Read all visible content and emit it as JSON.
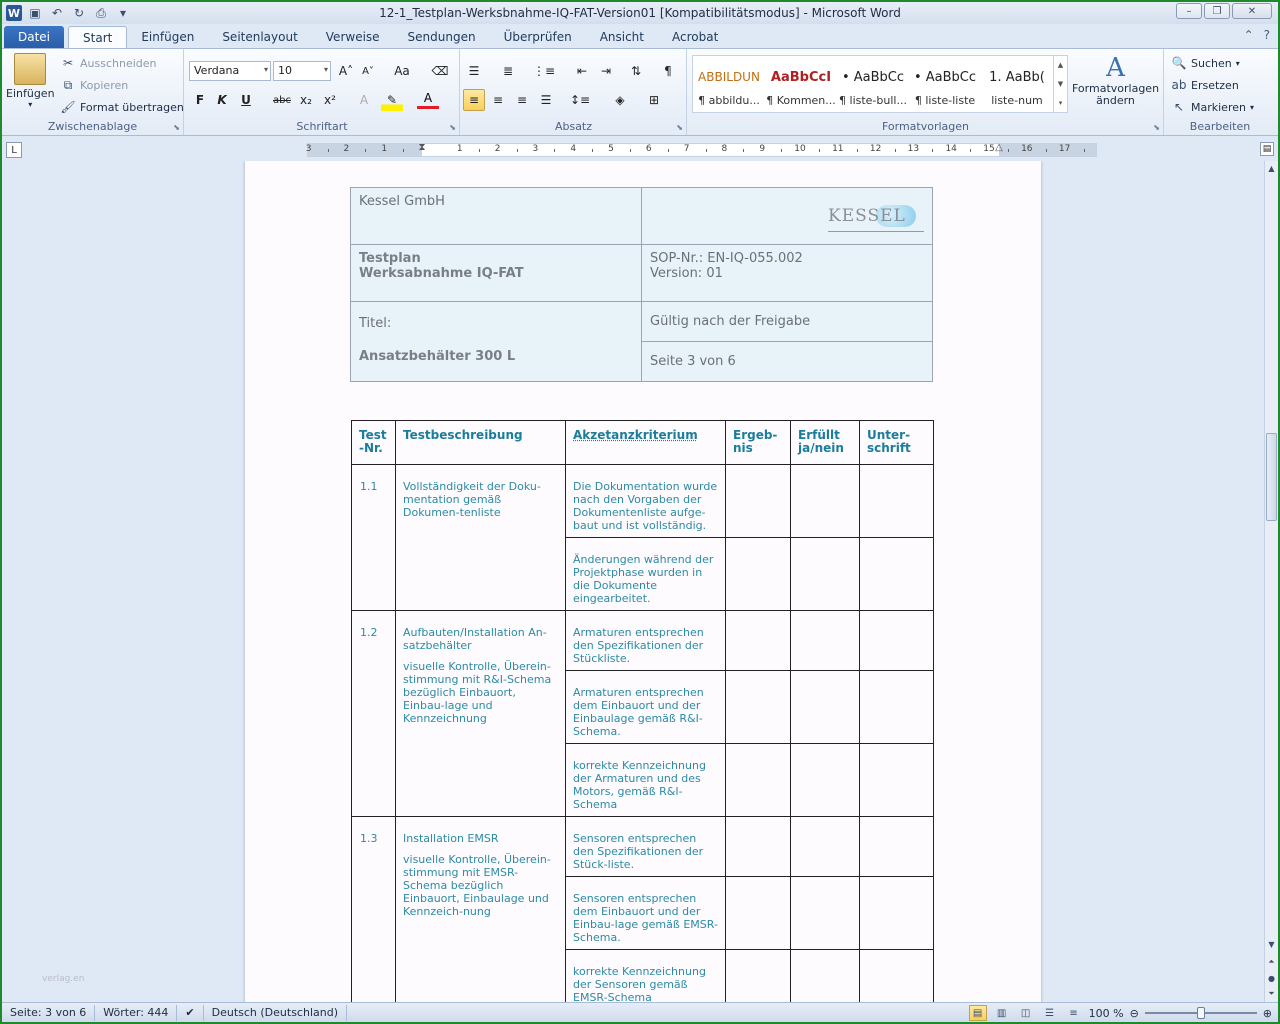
{
  "window": {
    "title": "12-1_Testplan-Werksbnahme-IQ-FAT-Version01 [Kompatibilitätsmodus] - Microsoft Word"
  },
  "tabs": [
    {
      "label": "Datei"
    },
    {
      "label": "Start"
    },
    {
      "label": "Einfügen"
    },
    {
      "label": "Seitenlayout"
    },
    {
      "label": "Verweise"
    },
    {
      "label": "Sendungen"
    },
    {
      "label": "Überprüfen"
    },
    {
      "label": "Ansicht"
    },
    {
      "label": "Acrobat"
    }
  ],
  "ribbon": {
    "clipboard": {
      "label": "Zwischenablage",
      "paste": "Einfügen",
      "cut": "Ausschneiden",
      "copy": "Kopieren",
      "format_painter": "Format übertragen"
    },
    "font": {
      "label": "Schriftart",
      "family": "Verdana",
      "size": "10",
      "bold": "F",
      "italic": "K",
      "underline": "U",
      "strike": "abc",
      "sub": "x₂",
      "sup": "x²"
    },
    "paragraph": {
      "label": "Absatz"
    },
    "styles": {
      "label": "Formatvorlagen",
      "items": [
        {
          "preview": "ABBILDUN",
          "name": "¶ abbildu..."
        },
        {
          "preview": "AaBbCcI",
          "name": "¶ Kommen..."
        },
        {
          "preview": "• AaBbCc",
          "name": "¶ liste-bull..."
        },
        {
          "preview": "• AaBbCc",
          "name": "¶ liste-liste"
        },
        {
          "preview": "1.  AaBb(",
          "name": "liste-num"
        }
      ],
      "change": "Formatvorlagen",
      "change2": "ändern"
    },
    "editing": {
      "label": "Bearbeiten",
      "find": "Suchen",
      "replace": "Ersetzen",
      "select": "Markieren"
    }
  },
  "ruler": {
    "labels": [
      "3",
      "2",
      "1",
      "1",
      "2",
      "3",
      "4",
      "5",
      "6",
      "7",
      "8",
      "9",
      "10",
      "11",
      "12",
      "13",
      "14",
      "15",
      "16",
      "17"
    ]
  },
  "document": {
    "header": {
      "company": "Kessel GmbH",
      "logo": "KESSEL",
      "doc_title_1": "Testplan",
      "doc_title_2": "Werksabnahme IQ-FAT",
      "sop": "SOP-Nr.: EN-IQ-055.002",
      "version": "Version:  01",
      "title_label": "Titel:",
      "title_value": "Ansatzbehälter 300 L",
      "valid": "Gültig  nach  der Freigabe",
      "page": "Seite  3  von  6"
    },
    "table": {
      "headers": [
        "Test -Nr.",
        "Testbeschreibung",
        "Akzetanzkriterium",
        "Ergeb-nis",
        "Erfüllt ja/nein",
        "Unter-schrift"
      ],
      "rows": [
        {
          "num": "1.1",
          "desc": [
            "Vollständigkeit der Doku-mentation gemäß Dokumen-tenliste"
          ],
          "criteria": [
            "Die Dokumentation wurde nach den Vorgaben der Dokumentenliste aufge-baut und ist vollständig.",
            "Änderungen während der Projektphase wurden in die Dokumente eingearbeitet."
          ]
        },
        {
          "num": "1.2",
          "desc": [
            "Aufbauten/Installation An-satzbehälter",
            "visuelle Kontrolle, Überein-stimmung mit R&I-Schema bezüglich Einbauort, Einbau-lage und Kennzeichnung"
          ],
          "criteria": [
            "Armaturen entsprechen den Spezifikationen der Stückliste.",
            "Armaturen entsprechen dem Einbauort und der Einbaulage gemäß R&I-Schema.",
            "korrekte Kennzeichnung der Armaturen und des Motors, gemäß R&I-Schema"
          ]
        },
        {
          "num": "1.3",
          "desc": [
            "Installation EMSR",
            "visuelle Kontrolle, Überein-stimmung mit EMSR-Schema bezüglich Einbauort, Einbaulage und Kennzeich-nung"
          ],
          "criteria": [
            "Sensoren entsprechen den Spezifikationen der Stück-liste.",
            "Sensoren entsprechen dem Einbauort und der Einbau-lage gemäß EMSR-Schema.",
            "korrekte Kennzeichnung der Sensoren gemäß EMSR-Schema"
          ]
        }
      ]
    },
    "watermark": "verlag.en"
  },
  "status": {
    "page": "Seite: 3 von 6",
    "words": "Wörter: 444",
    "language": "Deutsch (Deutschland)",
    "zoom": "100 %",
    "zoom_value": 100
  }
}
